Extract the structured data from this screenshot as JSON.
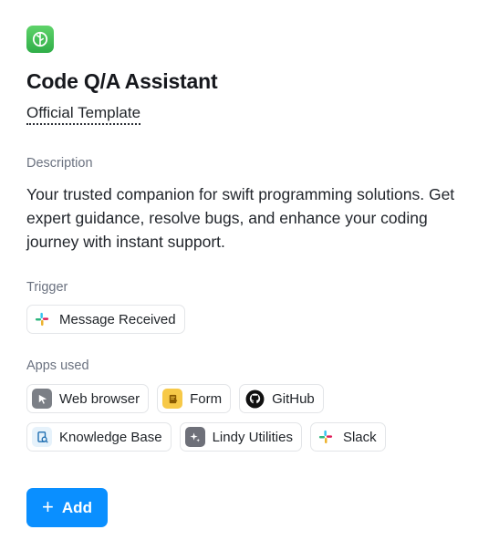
{
  "template": {
    "title": "Code Q/A Assistant",
    "official_label": "Official Template",
    "description_label": "Description",
    "description": "Your trusted companion for swift programming solutions. Get expert guidance, resolve bugs, and enhance your coding journey with instant support.",
    "trigger_label": "Trigger",
    "trigger": {
      "label": "Message Received",
      "icon": "slack-icon"
    },
    "apps_label": "Apps used",
    "apps": [
      {
        "label": "Web browser",
        "icon": "web-browser-icon"
      },
      {
        "label": "Form",
        "icon": "form-icon"
      },
      {
        "label": "GitHub",
        "icon": "github-icon"
      },
      {
        "label": "Knowledge Base",
        "icon": "knowledge-base-icon"
      },
      {
        "label": "Lindy Utilities",
        "icon": "lindy-utilities-icon"
      },
      {
        "label": "Slack",
        "icon": "slack-icon"
      }
    ]
  },
  "add_button": {
    "label": "Add",
    "icon": "plus-icon"
  },
  "colors": {
    "accent": "#0a8fff",
    "logo_green": "#2fae48",
    "muted_text": "#6b7280",
    "chip_border": "#e3e5e8"
  }
}
